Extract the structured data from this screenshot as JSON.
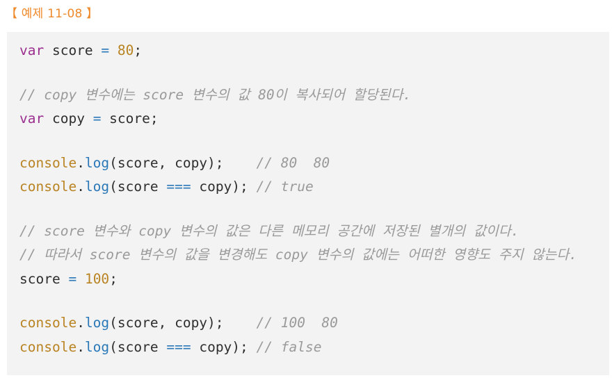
{
  "example_title": "【 예제 11-08 】",
  "code": {
    "l1": {
      "kw": "var",
      "name": " score ",
      "op": "=",
      "sp": " ",
      "num": "80",
      "end": ";"
    },
    "l2": {
      "comment": "// copy 변수에는 score 변수의 값 80이 복사되어 할당된다."
    },
    "l3": {
      "kw": "var",
      "name": " copy ",
      "op": "=",
      "rest": " score;"
    },
    "l4": {
      "obj": "console",
      "dot": ".",
      "fn": "log",
      "args": "(score, copy);",
      "pad": "    ",
      "comment": "// 80  80"
    },
    "l5": {
      "obj": "console",
      "dot": ".",
      "fn": "log",
      "args1": "(score ",
      "op": "===",
      "args2": " copy);",
      "pad": " ",
      "comment": "// true"
    },
    "l6": {
      "comment": "// score 변수와 copy 변수의 값은 다른 메모리 공간에 저장된 별개의 값이다."
    },
    "l7": {
      "comment": "// 따라서 score 변수의 값을 변경해도 copy 변수의 값에는 어떠한 영향도 주지 않는다."
    },
    "l8": {
      "name": "score ",
      "op": "=",
      "sp": " ",
      "num": "100",
      "end": ";"
    },
    "l9": {
      "obj": "console",
      "dot": ".",
      "fn": "log",
      "args": "(score, copy);",
      "pad": "    ",
      "comment": "// 100  80"
    },
    "l10": {
      "obj": "console",
      "dot": ".",
      "fn": "log",
      "args1": "(score ",
      "op": "===",
      "args2": " copy);",
      "pad": " ",
      "comment": "// false"
    }
  },
  "colors": {
    "keyword": "#9b2f8f",
    "number": "#b98322",
    "function": "#2a78b8",
    "comment": "#9a9a9a",
    "title": "#ef8a2c",
    "code_background": "#f3f3f3"
  }
}
